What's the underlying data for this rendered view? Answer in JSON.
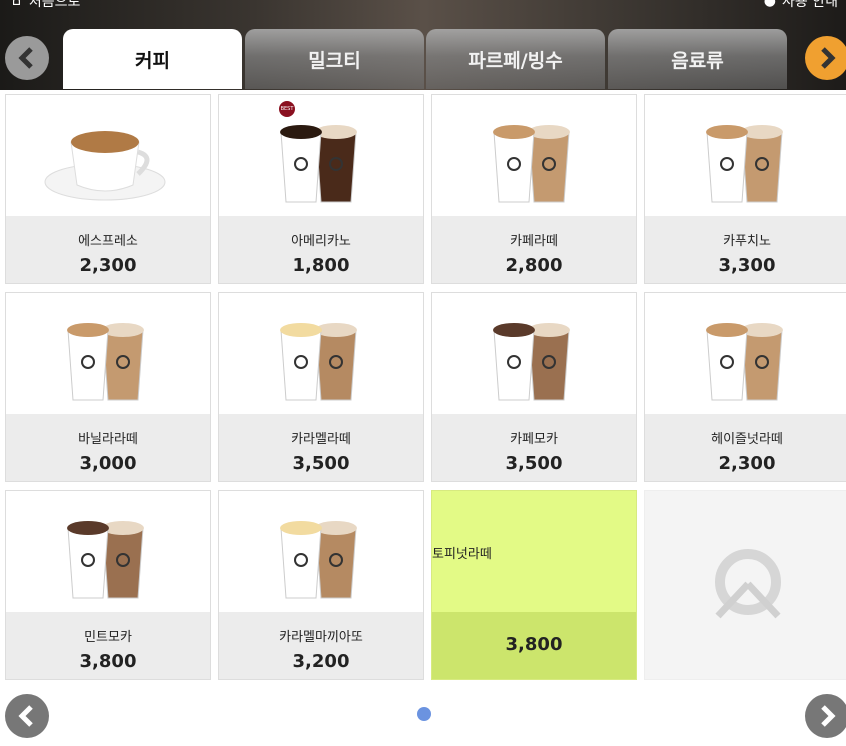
{
  "topbar": {
    "home_label": "처음으로",
    "help_label": "사용 안내"
  },
  "tabs": [
    {
      "label": "커피",
      "active": true
    },
    {
      "label": "밀크티"
    },
    {
      "label": "파르페/빙수"
    },
    {
      "label": "음료류"
    }
  ],
  "colors": {
    "accent": "#f0a030",
    "highlight": "#e3fa86",
    "pager_dot": "#6b93e0"
  },
  "products": [
    {
      "name": "에스프레소",
      "price": "2,300",
      "image": "espresso-cup"
    },
    {
      "name": "아메리카노",
      "price": "1,800",
      "image": "americano-cups",
      "badge": "BEST"
    },
    {
      "name": "카페라떼",
      "price": "2,800",
      "image": "latte-cups"
    },
    {
      "name": "카푸치노",
      "price": "3,300",
      "image": "latte-cups"
    },
    {
      "name": "바닐라라떼",
      "price": "3,000",
      "image": "latte-cups"
    },
    {
      "name": "카라멜라떼",
      "price": "3,500",
      "image": "caramel-cups"
    },
    {
      "name": "카페모카",
      "price": "3,500",
      "image": "mocha-cups"
    },
    {
      "name": "헤이즐넛라떼",
      "price": "2,300",
      "image": "latte-cups"
    },
    {
      "name": "민트모카",
      "price": "3,800",
      "image": "mocha-cups"
    },
    {
      "name": "카라멜마끼아또",
      "price": "3,200",
      "image": "caramel-cups"
    },
    {
      "name": "토피넛라떼",
      "price": "3,800",
      "highlighted": true
    }
  ],
  "pager": {
    "current": 1,
    "total": 1
  }
}
